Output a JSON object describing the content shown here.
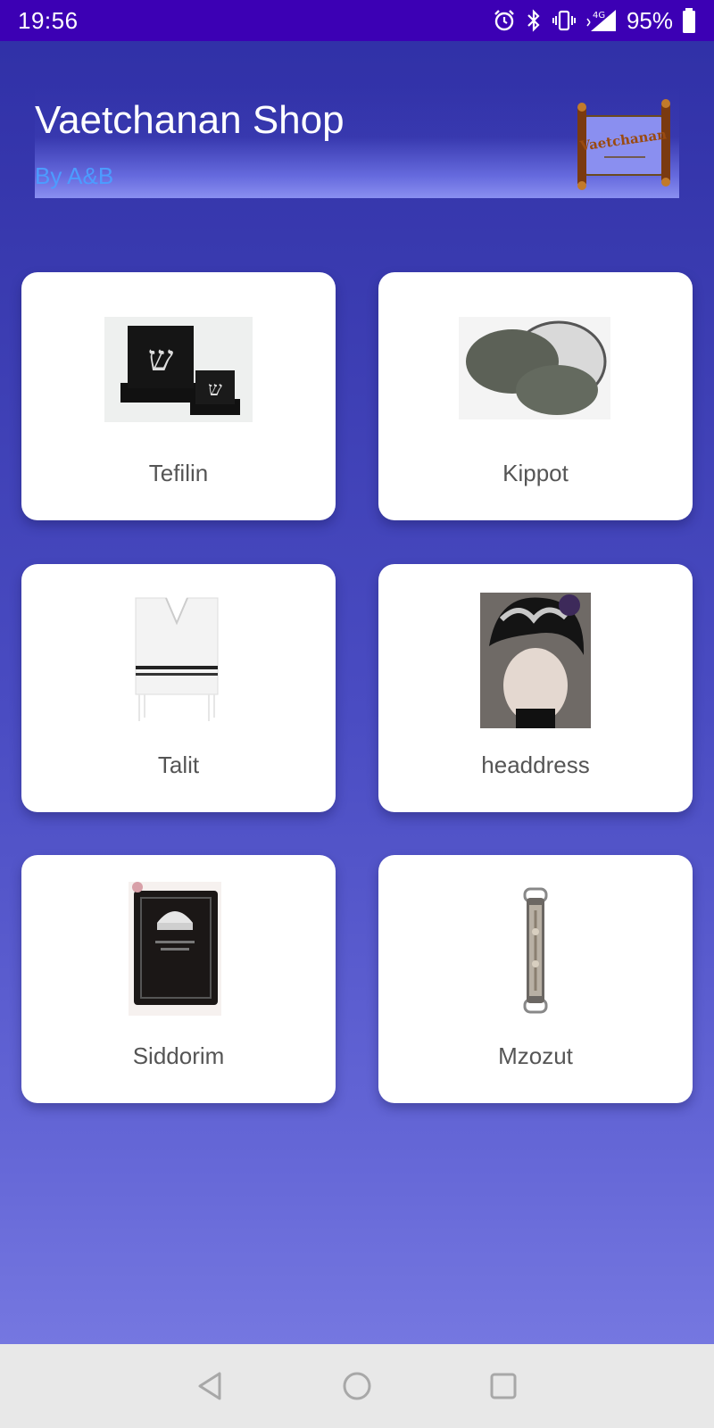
{
  "status_bar": {
    "time": "19:56",
    "network": "4G",
    "battery": "95%",
    "icons": [
      "alarm-icon",
      "bluetooth-icon",
      "vibrate-icon",
      "signal-icon",
      "battery-icon"
    ]
  },
  "header": {
    "title": "Vaetchanan Shop",
    "subtitle": "By A&B",
    "logo_text": "Vaetchanan"
  },
  "categories": [
    {
      "label": "Tefilin"
    },
    {
      "label": "Kippot"
    },
    {
      "label": "Talit"
    },
    {
      "label": "headdress"
    },
    {
      "label": "Siddorim"
    },
    {
      "label": "Mzozut"
    }
  ],
  "nav_bar": {
    "buttons": [
      "back-icon",
      "home-icon",
      "recents-icon"
    ]
  },
  "colors": {
    "status_bar": "#3c00b4",
    "subtitle": "#4c9cff",
    "card_label": "#555555"
  }
}
